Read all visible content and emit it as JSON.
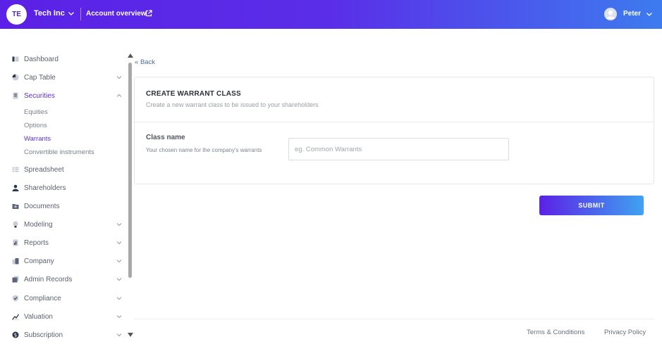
{
  "header": {
    "org_initials": "TE",
    "org_name": "Tech Inc",
    "account_link": "Account overview",
    "user_name": "Peter"
  },
  "sidebar": {
    "items": [
      {
        "label": "Dashboard",
        "icon": "dashboard-icon"
      },
      {
        "label": "Cap Table",
        "icon": "pie-chart-icon"
      },
      {
        "label": "Securities",
        "icon": "document-icon"
      },
      {
        "label": "Spreadsheet",
        "icon": "table-icon"
      },
      {
        "label": "Shareholders",
        "icon": "user-icon"
      },
      {
        "label": "Documents",
        "icon": "folder-icon"
      },
      {
        "label": "Modeling",
        "icon": "lightbulb-icon"
      },
      {
        "label": "Reports",
        "icon": "report-icon"
      },
      {
        "label": "Company",
        "icon": "building-icon"
      },
      {
        "label": "Admin Records",
        "icon": "records-icon"
      },
      {
        "label": "Compliance",
        "icon": "shield-icon"
      },
      {
        "label": "Valuation",
        "icon": "valuation-icon"
      },
      {
        "label": "Subscription",
        "icon": "dollar-icon"
      }
    ],
    "securities_sub": [
      "Equities",
      "Options",
      "Warrants",
      "Convertible instruments"
    ]
  },
  "main": {
    "back_label": "Back",
    "card_title": "CREATE WARRANT CLASS",
    "card_subtitle": "Create a new warrant class to be issued to your shareholders",
    "field_label": "Class name",
    "field_help": "Your chosen name for the company's warrants",
    "field_placeholder": "eg. Common Warrants",
    "submit_label": "SUBMIT"
  },
  "footer": {
    "terms": "Terms & Conditions",
    "privacy": "Privacy Policy"
  },
  "colors": {
    "brand_purple": "#5b21e6",
    "brand_blue": "#3d7bef",
    "active_nav": "#5b2fd9"
  }
}
